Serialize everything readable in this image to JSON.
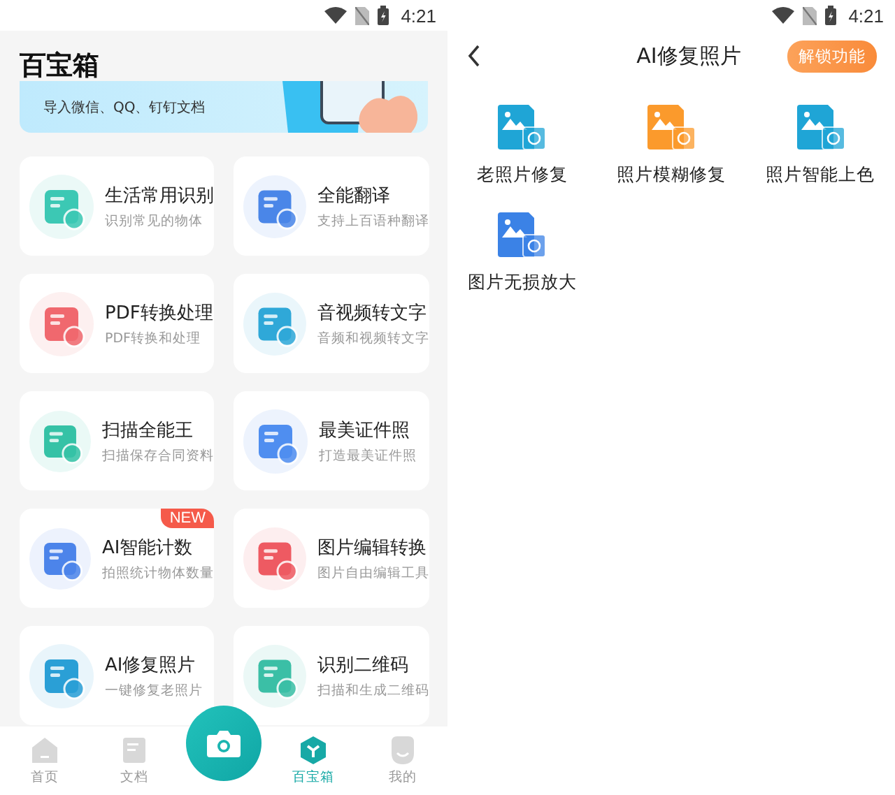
{
  "left": {
    "status_bar": {
      "time": "4:21"
    },
    "title": "百宝箱",
    "banner": {
      "text": "导入微信、QQ、钉钉文档"
    },
    "tools": [
      {
        "name": "生活常用识别",
        "desc": "识别常见的物体",
        "color": "#3cc8b4"
      },
      {
        "name": "全能翻译",
        "desc": "支持上百语种翻译",
        "color": "#4a86e8"
      },
      {
        "name": "PDF转换处理",
        "desc": "PDF转换和处理",
        "color": "#f0686e"
      },
      {
        "name": "音视频转文字",
        "desc": "音频和视频转文字",
        "color": "#2fa8d8"
      },
      {
        "name": "扫描全能王",
        "desc": "扫描保存合同资料",
        "color": "#35c2a6"
      },
      {
        "name": "最美证件照",
        "desc": "打造最美证件照",
        "color": "#4f8ef0"
      },
      {
        "name": "AI智能计数",
        "desc": "拍照统计物体数量",
        "color": "#4c84ea",
        "badge": "NEW"
      },
      {
        "name": "图片编辑转换",
        "desc": "图片自由编辑工具",
        "color": "#ee5a62"
      },
      {
        "name": "AI修复照片",
        "desc": "一键修复老照片",
        "color": "#2a9fd6"
      },
      {
        "name": "识别二维码",
        "desc": "扫描和生成二维码",
        "color": "#3bbfa6"
      }
    ],
    "nav": [
      {
        "label": "首页",
        "selected": false
      },
      {
        "label": "文档",
        "selected": false
      },
      {
        "label": "百宝箱",
        "selected": true
      },
      {
        "label": "我的",
        "selected": false
      }
    ]
  },
  "right": {
    "status_bar": {
      "time": "4:21"
    },
    "title": "AI修复照片",
    "unlock_button": "解锁功能",
    "features": [
      {
        "label": "老照片修复",
        "color": "#1fa5d6"
      },
      {
        "label": "照片模糊修复",
        "color": "#fb9a2c"
      },
      {
        "label": "照片智能上色",
        "color": "#1fa5d6"
      },
      {
        "label": "图片无损放大",
        "color": "#3b82e6"
      }
    ]
  }
}
